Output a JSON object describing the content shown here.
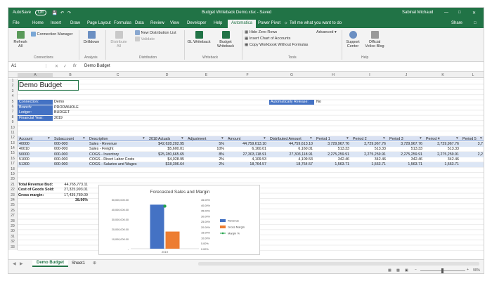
{
  "titlebar": {
    "autosave": "AutoSave",
    "autosave_state": "Off",
    "doc_title": "Budget Writeback Demo.xlsx  -  Saved",
    "user": "Sabinal Michaud"
  },
  "tabs": [
    "File",
    "Home",
    "Insert",
    "Draw",
    "Page Layout",
    "Formulas",
    "Data",
    "Review",
    "View",
    "Developer",
    "Help",
    "Automatica",
    "Power Pivot"
  ],
  "tell_me": "Tell me what you want to do",
  "share": "Share",
  "ribbon": {
    "refresh": "Refresh",
    "refresh_all": "All",
    "conn_mgr": "Connection Manager",
    "drilldown": "Drilldown",
    "distribute": "Distribute",
    "distribute_all": "All",
    "new_dist_list": "New Distribution List",
    "validate": "Validate",
    "gl_writeback": "GL Writeback",
    "budget_writeback": "Budget Writeback",
    "hide_zero": "Hide Zero Rows",
    "insert_coa": "Insert Chart of Accounts",
    "copy_wb": "Copy Workbook Without Formulas",
    "advanced": "Advanced",
    "support": "Support Center",
    "blog": "Official Velixo Blog",
    "groups": [
      "Connections",
      "Analysis",
      "Distribution",
      "Writeback",
      "Tools",
      "Help"
    ]
  },
  "formula_bar": {
    "name_box": "A1",
    "fx": "fx",
    "content": "Demo Budget"
  },
  "columns": [
    "A",
    "B",
    "C",
    "D",
    "E",
    "F",
    "G",
    "H",
    "I",
    "J",
    "K",
    "L"
  ],
  "rows": [
    "1",
    "2",
    "3",
    "4",
    "5",
    "6",
    "7",
    "8",
    "9",
    "10",
    "11",
    "12",
    "13",
    "14",
    "15",
    "16",
    "17",
    "18",
    "19",
    "20",
    "21",
    "22",
    "23",
    "24",
    "25",
    "26",
    "27",
    "28",
    "29",
    "30",
    "31",
    "32",
    "33"
  ],
  "sheet": {
    "title": "Demo Budget",
    "info_labels": [
      "Connection:",
      "Branch:",
      "Ledger:",
      "Financial Year:"
    ],
    "info_values": [
      "Demo",
      "PRODWHOLE",
      "BUDGET",
      "2019"
    ],
    "auto_release_label": "Automatically Release:",
    "auto_release_value": "No",
    "headers": [
      "Account",
      "Subaccount",
      "Description",
      "2018 Actuals",
      "Adjustment",
      "Amount",
      "Distributed Amount",
      "Period 1",
      "Period 2",
      "Period 3",
      "Period 4",
      "Period 5"
    ],
    "data": [
      [
        "40000",
        "000-000",
        "Sales - Revenue",
        "$42,628,202.95",
        "5%",
        "44,759,613.10",
        "44,759,613.10",
        "3,729,967.76",
        "3,729,967.76",
        "3,729,967.76",
        "3,729,967.76",
        "3,7"
      ],
      [
        "40010",
        "000-000",
        "Sales - Freight",
        "$5,600.01",
        "10%",
        "6,160.01",
        "6,160.01",
        "513.33",
        "513.33",
        "513.33",
        "513.33",
        ""
      ],
      [
        "50000",
        "000-000",
        "COGS - Inventory",
        "$25,280,665.65",
        "8%",
        "27,303,118.91",
        "27,303,118.91",
        "2,275,259.91",
        "2,275,259.91",
        "2,275,259.91",
        "2,275,259.91",
        "2,2"
      ],
      [
        "51000",
        "000-000",
        "COGS - Direct Labor Costs",
        "$4,028.95",
        "2%",
        "4,109.53",
        "4,109.53",
        "342.46",
        "342.46",
        "342.46",
        "342.46",
        ""
      ],
      [
        "51300",
        "000-000",
        "COGS - Salaries and Wages",
        "$18,396.64",
        "2%",
        "18,764.57",
        "18,764.57",
        "1,563.71",
        "1,563.71",
        "1,563.71",
        "1,563.71",
        ""
      ]
    ],
    "summary_labels": [
      "Total Revenue Bud:",
      "Cost of Goods Sold:",
      "Gross margin:"
    ],
    "summary_values": [
      "44,765,773.11",
      "27,325,993.01",
      "17,439,780.09",
      "38.96%"
    ]
  },
  "chart_data": {
    "type": "bar",
    "title": "Forecasted Sales and Margin",
    "categories": [
      "2019"
    ],
    "series": [
      {
        "name": "Revenue",
        "values": [
          44765773.11
        ],
        "color": "#4472c4"
      },
      {
        "name": "Gross Margin",
        "values": [
          17439780.09
        ],
        "color": "#ed7d31"
      },
      {
        "name": "Margin %",
        "values": [
          38.96
        ],
        "color": "#22a34a",
        "type": "line",
        "axis": "right"
      }
    ],
    "yticks": [
      "50,000,000.00",
      "40,000,000.00",
      "30,000,000.00",
      "20,000,000.00",
      "10,000,000.00",
      "-"
    ],
    "y2ticks": [
      "45.00%",
      "40.00%",
      "35.00%",
      "30.00%",
      "25.00%",
      "20.00%",
      "15.00%",
      "10.00%",
      "5.00%",
      "0.00%"
    ],
    "ylim": [
      0,
      50000000
    ],
    "y2lim": [
      0,
      45
    ],
    "legend": "right"
  },
  "sheet_tabs": [
    "Demo Budget",
    "Sheet1"
  ],
  "zoom": "90%"
}
